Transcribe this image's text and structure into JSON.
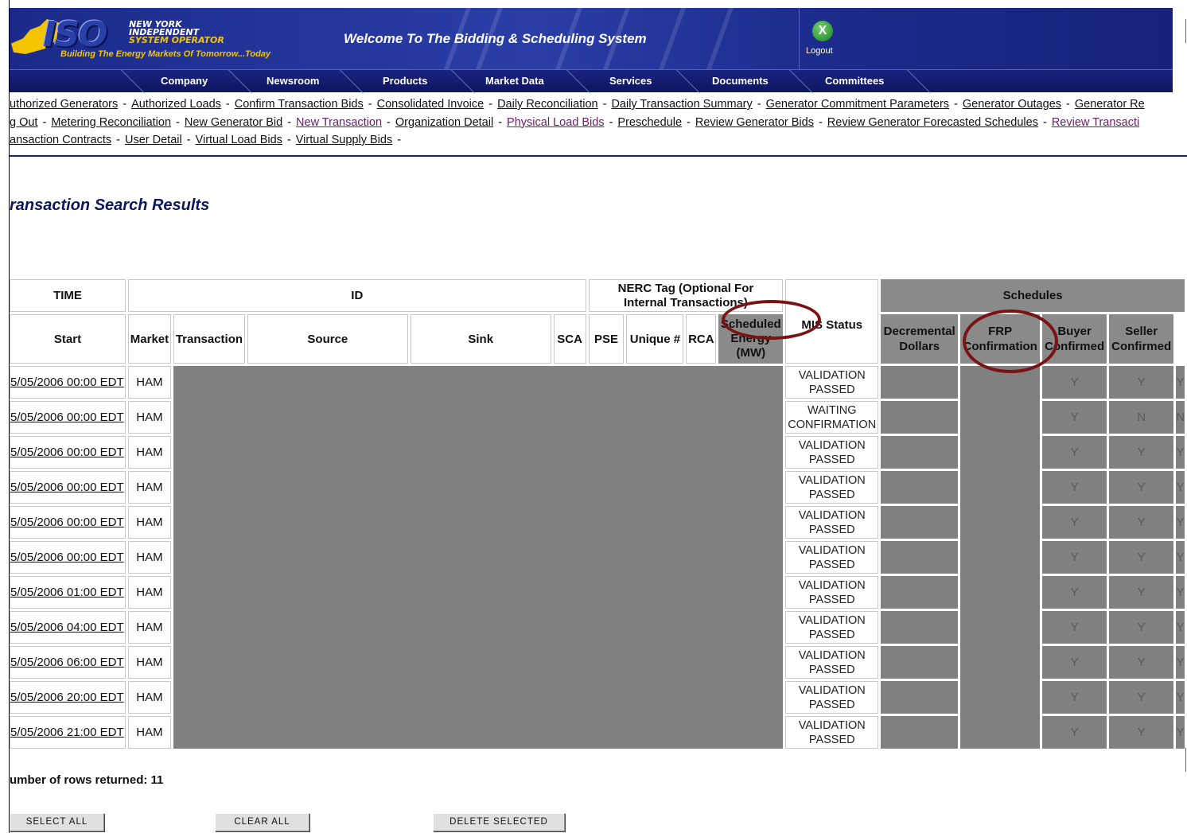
{
  "header": {
    "logo_text": "ISO",
    "logo_lines": [
      "NEW YORK",
      "INDEPENDENT",
      "SYSTEM OPERATOR"
    ],
    "tagline": "Building The Energy Markets Of Tomorrow...Today",
    "welcome": "Welcome To The Bidding & Scheduling System",
    "logout_icon": "X",
    "logout_label": "Logout"
  },
  "nav": {
    "items": [
      "Company",
      "Newsroom",
      "Products",
      "Market Data",
      "Services",
      "Documents",
      "Committees"
    ]
  },
  "links": {
    "row1": [
      "uthorized Generators",
      "Authorized Loads",
      "Confirm Transaction Bids",
      "Consolidated Invoice",
      "Daily Reconciliation",
      "Daily Transaction Summary",
      "Generator Commitment Parameters",
      "Generator Outages",
      "Generator Re"
    ],
    "row2": [
      "g Out",
      "Metering Reconciliation",
      "New Generator Bid",
      "New Transaction",
      "Organization Detail",
      "Physical Load Bids",
      "Preschedule",
      "Review Generator Bids",
      "Review Generator Forecasted Schedules",
      "Review Transacti"
    ],
    "row3": [
      "ansaction Contracts",
      "User Detail",
      "Virtual Load Bids",
      "Virtual Supply Bids"
    ],
    "separator": "-"
  },
  "page_title": "ransaction Search Results",
  "table": {
    "group_headers": {
      "time": "TIME",
      "id": "ID",
      "nerc_line1": "NERC Tag (Optional For",
      "nerc_line2": "Internal Transactions)",
      "schedules": "Schedules"
    },
    "columns": {
      "start": "Start",
      "market": "Market",
      "transaction": "Transaction",
      "source": "Source",
      "sink": "Sink",
      "sca": "SCA",
      "pse": "PSE",
      "unique": "Unique #",
      "rca": "RCA",
      "mis_status": "MIS Status",
      "scheduled_energy_1": "Scheduled",
      "scheduled_energy_2": "Energy",
      "scheduled_energy_3": "(MW)",
      "decremental_1": "Decremental",
      "decremental_2": "Dollars",
      "frp_1": "FRP",
      "frp_2": "Confirmation",
      "buyer_1": "Buyer",
      "buyer_2": "Confirmed",
      "seller_1": "Seller",
      "seller_2": "Confirmed"
    },
    "rows": [
      {
        "start": "5/05/2006 00:00 EDT",
        "market": "HAM",
        "mis1": "VALIDATION",
        "mis2": "PASSED",
        "frp": "Y",
        "buyer": "Y",
        "seller": "Y"
      },
      {
        "start": "5/05/2006 00:00 EDT",
        "market": "HAM",
        "mis1": "WAITING",
        "mis2": "CONFIRMATION",
        "frp": "Y",
        "buyer": "N",
        "seller": "N"
      },
      {
        "start": "5/05/2006 00:00 EDT",
        "market": "HAM",
        "mis1": "VALIDATION",
        "mis2": "PASSED",
        "frp": "Y",
        "buyer": "Y",
        "seller": "Y"
      },
      {
        "start": "5/05/2006 00:00 EDT",
        "market": "HAM",
        "mis1": "VALIDATION",
        "mis2": "PASSED",
        "frp": "Y",
        "buyer": "Y",
        "seller": "Y"
      },
      {
        "start": "5/05/2006 00:00 EDT",
        "market": "HAM",
        "mis1": "VALIDATION",
        "mis2": "PASSED",
        "frp": "Y",
        "buyer": "Y",
        "seller": "Y"
      },
      {
        "start": "5/05/2006 00:00 EDT",
        "market": "HAM",
        "mis1": "VALIDATION",
        "mis2": "PASSED",
        "frp": "Y",
        "buyer": "Y",
        "seller": "Y"
      },
      {
        "start": "5/05/2006 01:00 EDT",
        "market": "HAM",
        "mis1": "VALIDATION",
        "mis2": "PASSED",
        "frp": "Y",
        "buyer": "Y",
        "seller": "Y"
      },
      {
        "start": "5/05/2006 04:00 EDT",
        "market": "HAM",
        "mis1": "VALIDATION",
        "mis2": "PASSED",
        "frp": "Y",
        "buyer": "Y",
        "seller": "Y"
      },
      {
        "start": "5/05/2006 06:00 EDT",
        "market": "HAM",
        "mis1": "VALIDATION",
        "mis2": "PASSED",
        "frp": "Y",
        "buyer": "Y",
        "seller": "Y"
      },
      {
        "start": "5/05/2006 20:00 EDT",
        "market": "HAM",
        "mis1": "VALIDATION",
        "mis2": "PASSED",
        "frp": "Y",
        "buyer": "Y",
        "seller": "Y"
      },
      {
        "start": "5/05/2006 21:00 EDT",
        "market": "HAM",
        "mis1": "VALIDATION",
        "mis2": "PASSED",
        "frp": "Y",
        "buyer": "Y",
        "seller": "Y"
      }
    ]
  },
  "footer": {
    "rows_returned": "umber of rows returned: 11",
    "select_all": "SELECT ALL",
    "clear_all": "CLEAR ALL",
    "delete_selected": "DELETE SELECTED"
  },
  "colors": {
    "header_blue": "#1b2a8a",
    "nav_blue": "#1a237e",
    "logo_yellow": "#f5c400",
    "annotation_red": "#7a1414",
    "redacted_gray": "#808080",
    "visited_link": "#6b1d6b"
  }
}
